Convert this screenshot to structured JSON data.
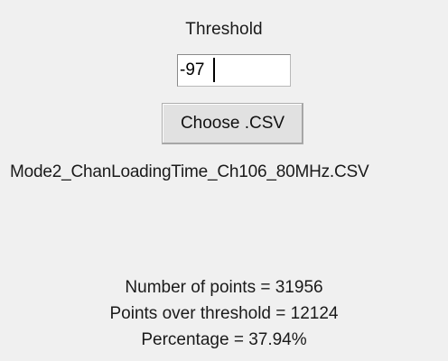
{
  "threshold": {
    "label": "Threshold",
    "value": "-97"
  },
  "choose_button": {
    "label": "Choose .CSV"
  },
  "file": {
    "name": "Mode2_ChanLoadingTime_Ch106_80MHz.CSV"
  },
  "stats": {
    "points": "Number of points = 31956",
    "over_threshold": "Points over threshold = 12124",
    "percentage": "Percentage = 37.94%"
  }
}
